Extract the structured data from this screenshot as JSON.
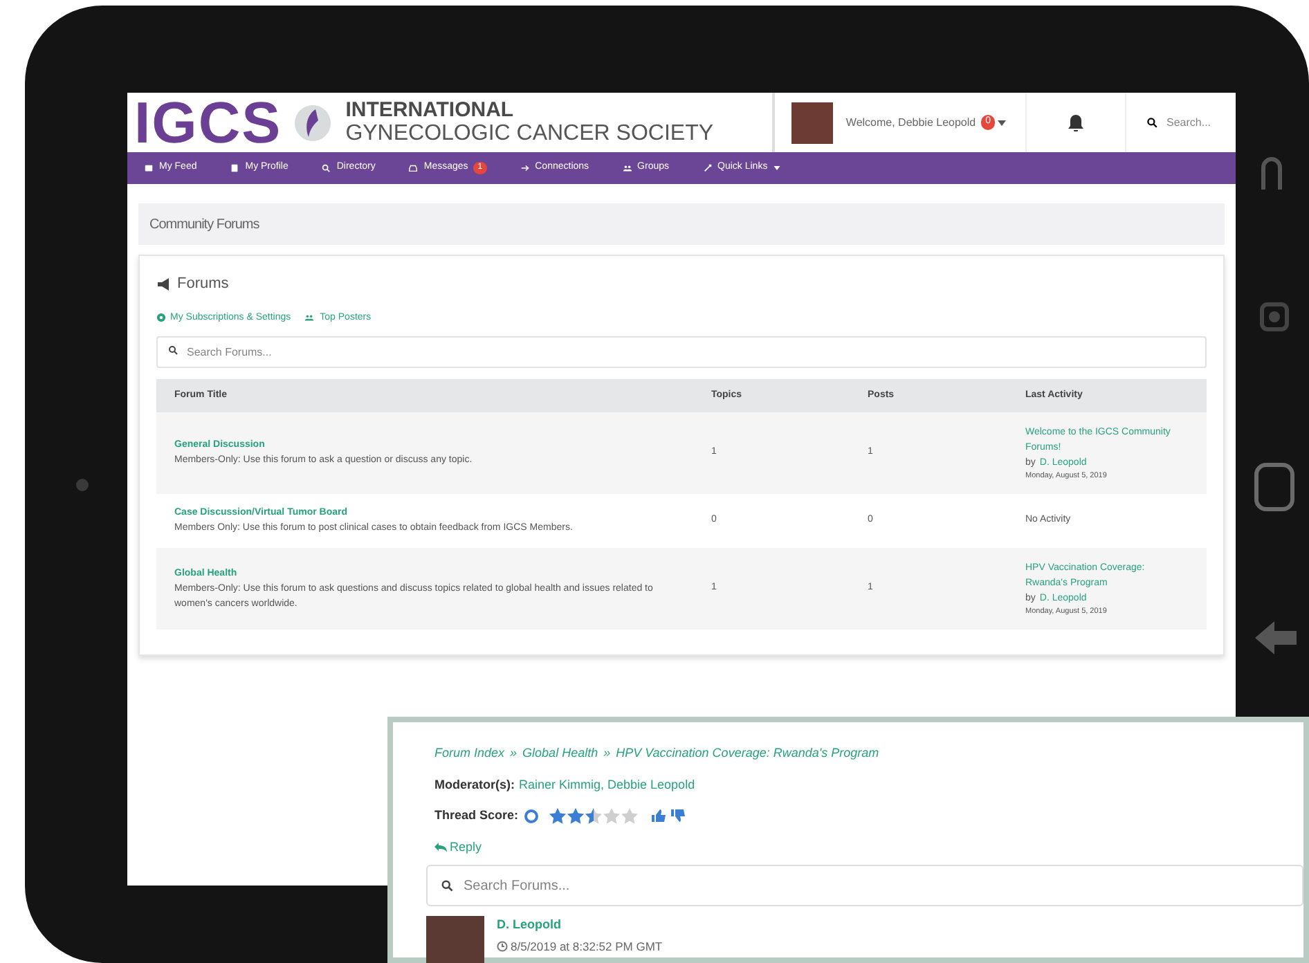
{
  "header": {
    "logo": {
      "abbr": "IGCS",
      "line1": "INTERNATIONAL",
      "line2": "GYNECOLOGIC CANCER SOCIETY"
    },
    "welcome": "Welcome, Debbie Leopold",
    "welcome_badge": "0",
    "search_placeholder": "Search..."
  },
  "nav": [
    {
      "label": "My Feed"
    },
    {
      "label": "My Profile"
    },
    {
      "label": "Directory"
    },
    {
      "label": "Messages",
      "badge": "1"
    },
    {
      "label": "Connections"
    },
    {
      "label": "Groups"
    },
    {
      "label": "Quick Links",
      "dropdown": true
    }
  ],
  "page_title": "Community Forums",
  "forums": {
    "heading": "Forums",
    "links": [
      "My Subscriptions & Settings",
      "Top Posters"
    ],
    "search_placeholder": "Search Forums...",
    "columns": [
      "Forum Title",
      "Topics",
      "Posts",
      "Last Activity"
    ],
    "rows": [
      {
        "title": "General Discussion",
        "description": "Members-Only: Use this forum to ask a question or discuss any topic.",
        "topics": "1",
        "posts": "1",
        "last_activity": {
          "title": "Welcome to the IGCS Community Forums!",
          "by": "by",
          "author": "D. Leopold",
          "date": "Monday, August 5, 2019"
        }
      },
      {
        "title": "Case Discussion/Virtual Tumor Board",
        "description": "Members Only: Use this forum to post clinical cases to obtain feedback from IGCS Members.",
        "topics": "0",
        "posts": "0",
        "last_activity": {
          "text": "No Activity"
        }
      },
      {
        "title": "Global Health",
        "description": "Members-Only: Use this forum to ask questions and discuss topics related to global health and issues related to women's cancers worldwide.",
        "topics": "1",
        "posts": "1",
        "last_activity": {
          "title": "HPV Vaccination Coverage: Rwanda's Program",
          "by": "by",
          "author": "D. Leopold",
          "date": "Monday, August 5, 2019"
        }
      }
    ]
  },
  "thread": {
    "breadcrumb": [
      "Forum Index",
      "Global Health",
      "HPV Vaccination Coverage: Rwanda's Program"
    ],
    "separator": "»",
    "moderators_label": "Moderator(s):",
    "moderators": "Rainer Kimmig, Debbie Leopold",
    "score_label": "Thread Score:",
    "stars": 2.5,
    "reply": "Reply",
    "search_placeholder": "Search Forums...",
    "post": {
      "author": "D. Leopold",
      "time": "8/5/2019 at 8:32:52 PM GMT"
    }
  }
}
